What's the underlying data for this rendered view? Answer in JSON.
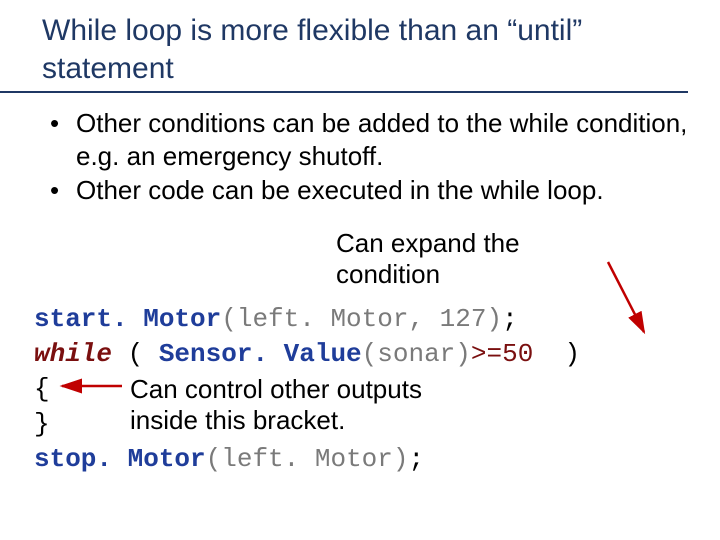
{
  "title": "While loop is more flexible than an “until” statement",
  "bullets": [
    "Other conditions can be added to the while condition, e.g. an emergency shutoff.",
    "Other code can be executed in the while loop."
  ],
  "annot_expand_line1": "Can expand the",
  "annot_expand_line2": "condition",
  "annot_bracket_line1": "Can control other outputs",
  "annot_bracket_line2": "inside this bracket.",
  "code": {
    "startMotor": "start. Motor",
    "startArgs": "(left. Motor, 127)",
    "semi": ";",
    "while": "while",
    "openParen": " ( ",
    "sensorValue": "Sensor. Value",
    "sonar": "(sonar)",
    "gte50": ">=50",
    "closeParen": "  )",
    "lbrace": "{",
    "rbrace": "}",
    "stopMotor": "stop. Motor",
    "stopArgs": "(left. Motor)"
  }
}
